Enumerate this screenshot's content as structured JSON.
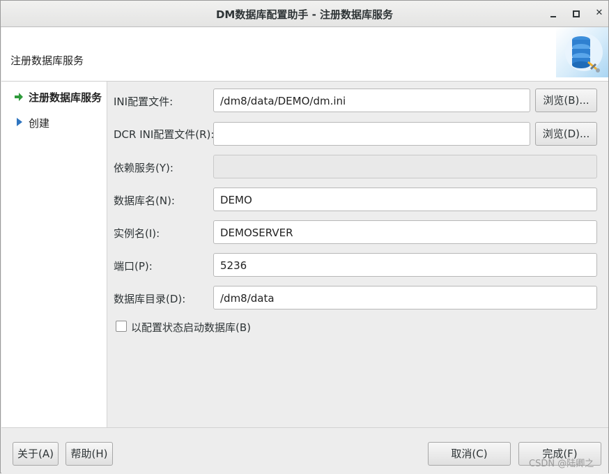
{
  "window": {
    "title": "DM数据库配置助手 - 注册数据库服务",
    "minimize_label": "",
    "close_label": "✕"
  },
  "header": {
    "title": "注册数据库服务"
  },
  "sidebar": {
    "items": [
      {
        "label": "注册数据库服务",
        "active": true,
        "icon": "arrow-right-icon"
      },
      {
        "label": "创建",
        "active": false,
        "icon": "triangle-right-icon"
      }
    ]
  },
  "form": {
    "ini_file": {
      "label": "INI配置文件:",
      "value": "/dm8/data/DEMO/dm.ini",
      "browse": "浏览(B)..."
    },
    "dcr_ini_file": {
      "label": "DCR INI配置文件(R):",
      "value": "",
      "browse": "浏览(D)..."
    },
    "depend_service": {
      "label": "依赖服务(Y):",
      "value": ""
    },
    "db_name": {
      "label": "数据库名(N):",
      "value": "DEMO"
    },
    "instance_name": {
      "label": "实例名(I):",
      "value": "DEMOSERVER"
    },
    "port": {
      "label": "端口(P):",
      "value": "5236"
    },
    "db_dir": {
      "label": "数据库目录(D):",
      "value": "/dm8/data"
    },
    "start_with_config": {
      "label": "以配置状态启动数据库(B)",
      "checked": false
    }
  },
  "footer": {
    "about": "关于(A)",
    "help": "帮助(H)",
    "cancel": "取消(C)",
    "finish": "完成(F)"
  },
  "watermark": "CSDN @陆卿之",
  "colors": {
    "arrow": "#2f9a3c",
    "triangle": "#2f75c0",
    "db_icon": "#2f80d0"
  }
}
